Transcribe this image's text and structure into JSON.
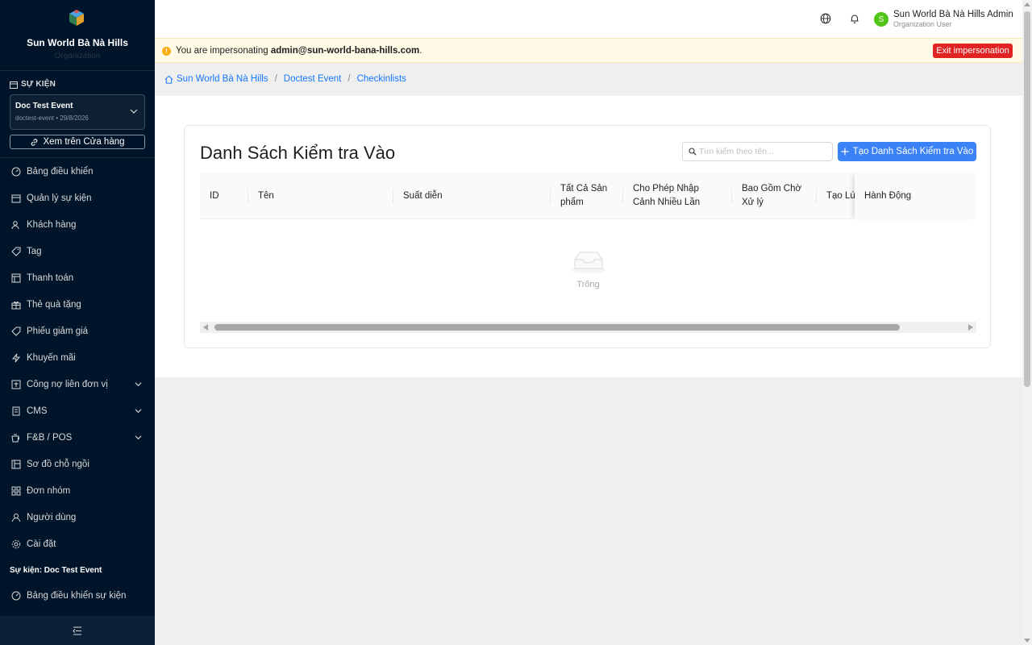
{
  "sidebar": {
    "brand_name": "Sun World Bà Nà Hills",
    "brand_sub": "Organization",
    "section_title": "SỰ KIỆN",
    "event": {
      "name": "Doc Test Event",
      "meta": "doctest-event • 29/8/2026"
    },
    "store_button": "Xem trên Cửa hàng",
    "menu": [
      {
        "label": "Bảng điều khiển",
        "icon": "dashboard-icon"
      },
      {
        "label": "Quản lý sự kiện",
        "icon": "calendar-icon"
      },
      {
        "label": "Khách hàng",
        "icon": "user-icon"
      },
      {
        "label": "Tag",
        "icon": "tag-icon"
      },
      {
        "label": "Thanh toán",
        "icon": "payment-icon"
      },
      {
        "label": "Thẻ quà tặng",
        "icon": "gift-icon"
      },
      {
        "label": "Phiếu giảm giá",
        "icon": "coupon-icon"
      },
      {
        "label": "Khuyến mãi",
        "icon": "lightning-icon"
      },
      {
        "label": "Công nợ liên đơn vị",
        "icon": "ledger-icon",
        "has_children": true
      },
      {
        "label": "CMS",
        "icon": "cms-icon",
        "has_children": true
      },
      {
        "label": "F&B / POS",
        "icon": "coffee-icon",
        "has_children": true
      },
      {
        "label": "Sơ đồ chỗ ngồi",
        "icon": "seat-map-icon"
      },
      {
        "label": "Đơn nhóm",
        "icon": "group-order-icon"
      },
      {
        "label": "Người dùng",
        "icon": "person-icon"
      },
      {
        "label": "Cài đặt",
        "icon": "settings-icon"
      }
    ],
    "event_section_title": "Sự kiện: Doc Test Event",
    "event_dashboard": {
      "label": "Bảng điều khiển sự kiện",
      "icon": "dashboard-icon"
    }
  },
  "header": {
    "user_initial": "S",
    "user_name": "Sun World Bà Nà Hills Admin",
    "user_role": "Organization User",
    "avatar_color": "#52c41a"
  },
  "banner": {
    "prefix": "You are impersonating ",
    "email": "admin@sun-world-bana-hills.com",
    "suffix": ".",
    "exit_label": "Exit impersonation"
  },
  "breadcrumb": {
    "items": [
      "Sun World Bà Nà Hills",
      "Doctest Event",
      "Checkinlists"
    ]
  },
  "page": {
    "title": "Danh Sách Kiểm tra Vào",
    "search_placeholder": "Tìm kiếm theo tên...",
    "create_label": "Tạo Danh Sách Kiểm tra Vào",
    "columns": [
      {
        "key": "id",
        "label": "ID"
      },
      {
        "key": "name",
        "label": "Tên"
      },
      {
        "key": "performance",
        "label": "Suất diễn"
      },
      {
        "key": "all_products",
        "label": "Tất Cả Sản phẩm"
      },
      {
        "key": "multi_entry",
        "label": "Cho Phép Nhập Cảnh Nhiều Lần"
      },
      {
        "key": "include_pending",
        "label": "Bao Gồm Chờ Xử lý"
      },
      {
        "key": "created_at",
        "label": "Tạo Lúc"
      },
      {
        "key": "actions",
        "label": "Hành Động"
      }
    ],
    "empty_text": "Trống"
  },
  "colors": {
    "sidebar_bg": "#001529",
    "primary": "#3b82f6",
    "link": "#1677ff",
    "danger": "#e02424",
    "warning": "#faad14"
  }
}
